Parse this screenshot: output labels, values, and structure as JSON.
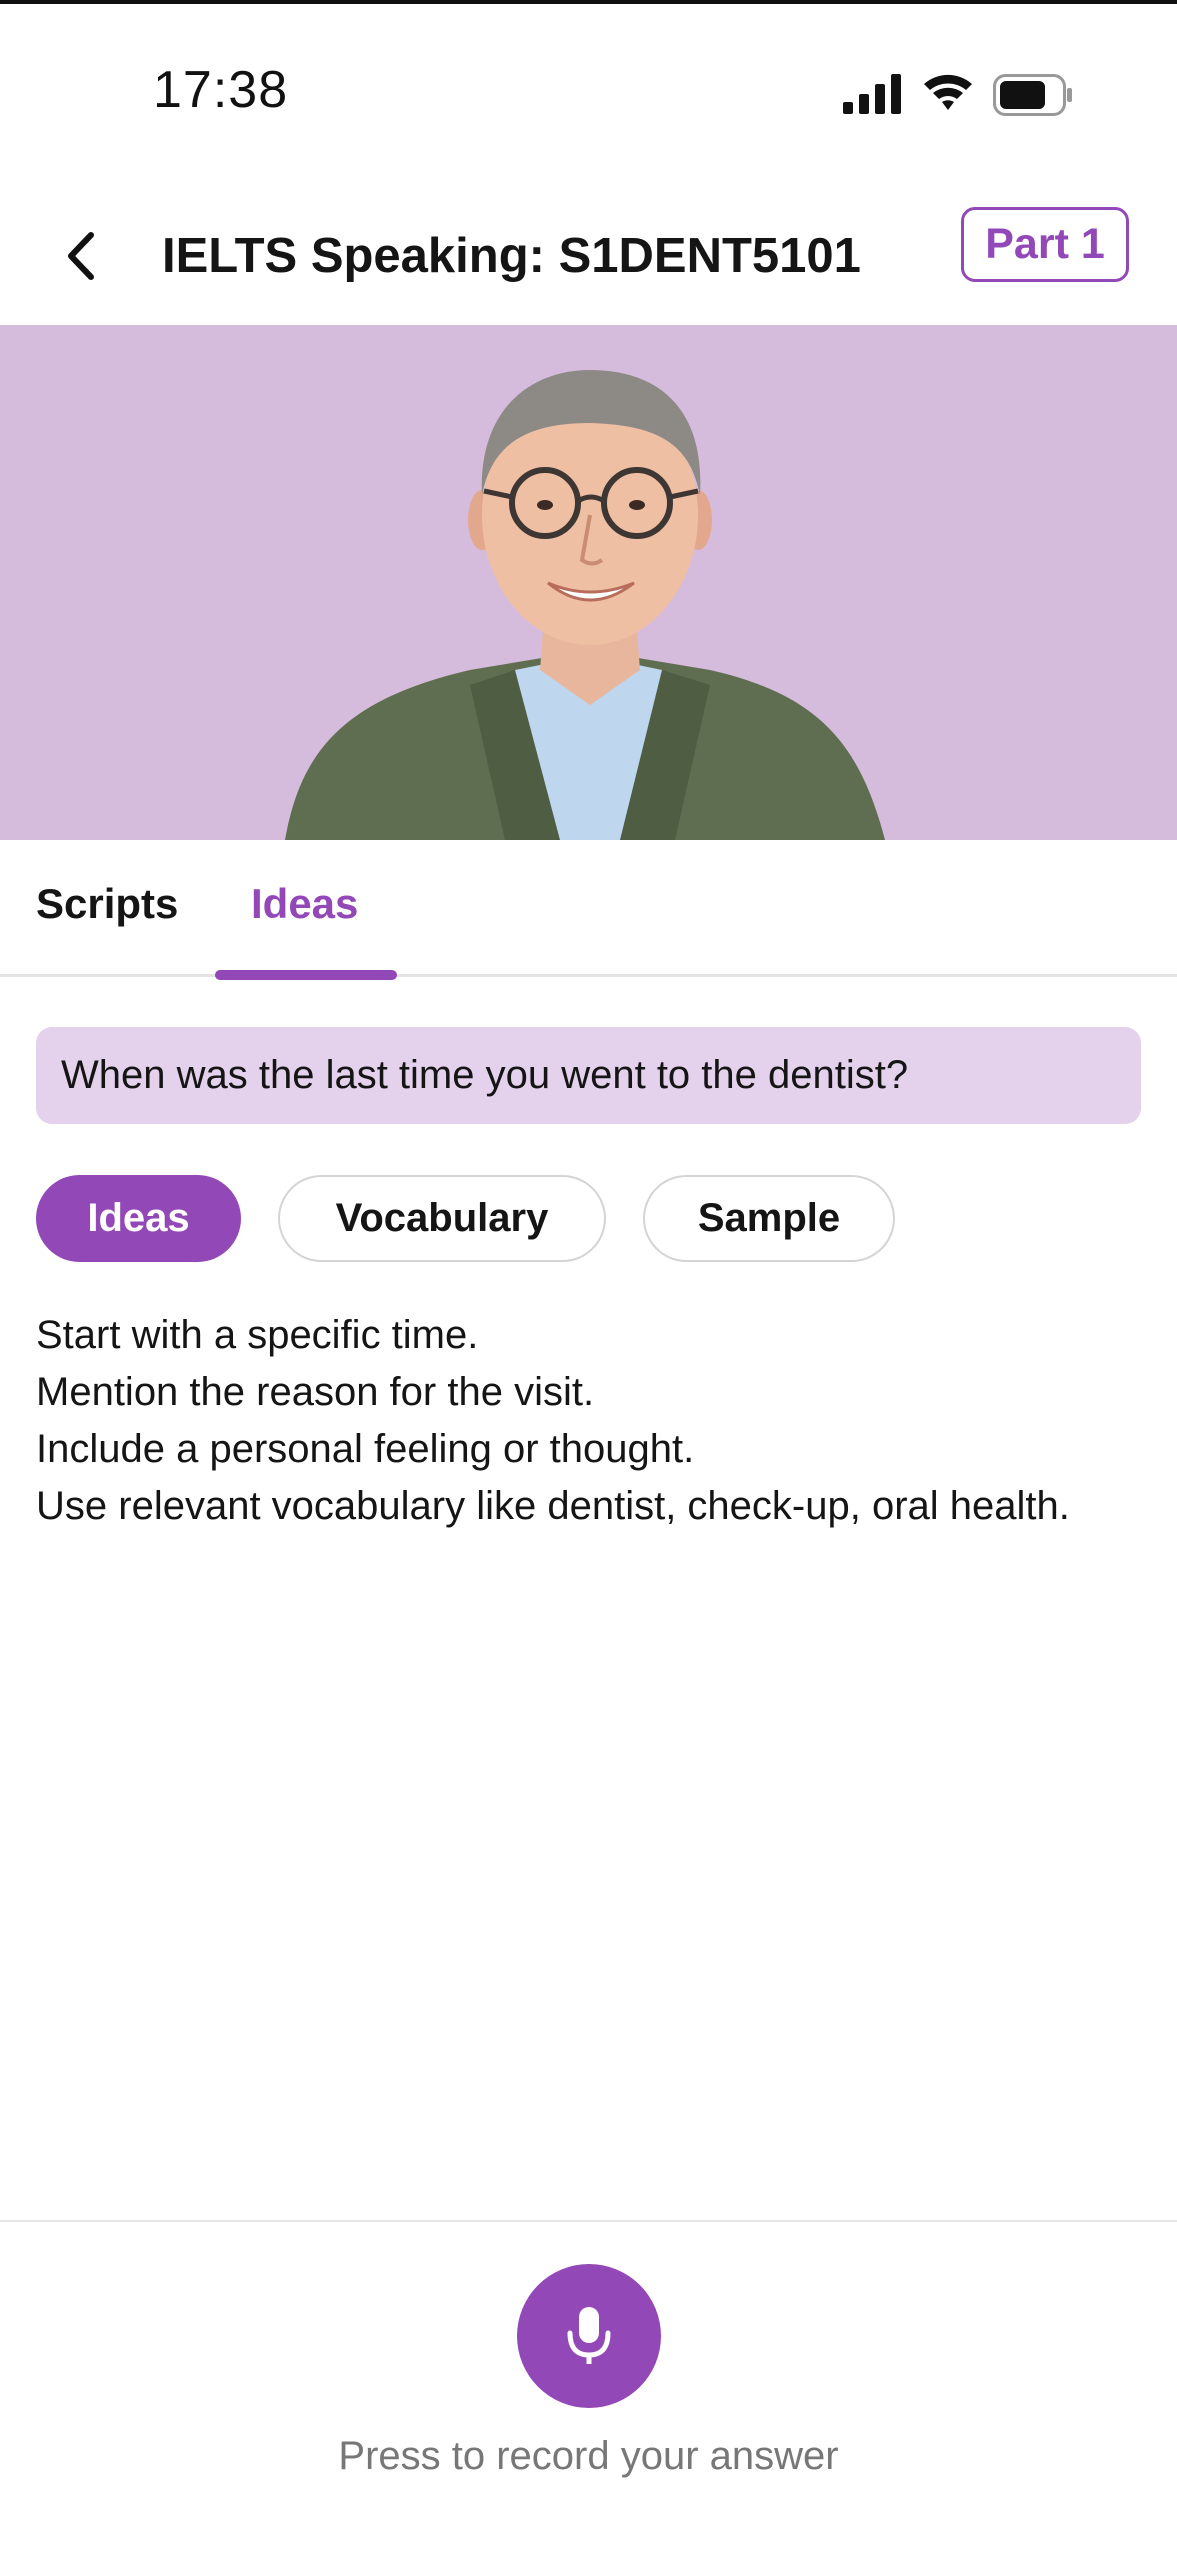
{
  "status_bar": {
    "time": "17:38",
    "icons": [
      "signal-icon",
      "wifi-icon",
      "battery-icon"
    ]
  },
  "header": {
    "back_icon": "chevron-left-icon",
    "title": "IELTS Speaking: S1DENT5101",
    "part_label": "Part 1"
  },
  "hero": {
    "image": "examiner-portrait",
    "background_color": "#d5bcdc"
  },
  "tabs": {
    "items": [
      "Scripts",
      "Ideas"
    ],
    "active": "Ideas"
  },
  "question": "When was the last time you went to the dentist?",
  "chips": {
    "items": [
      "Ideas",
      "Vocabulary",
      "Sample"
    ],
    "active": "Ideas"
  },
  "ideas": [
    "Start with a specific time.",
    "Mention the reason for the visit.",
    "Include a personal feeling or thought.",
    "Use relevant vocabulary like dentist, check-up, oral health."
  ],
  "record": {
    "icon": "microphone-icon",
    "hint": "Press to record your answer"
  },
  "colors": {
    "accent": "#9348b8",
    "question_bg": "#e4d1ec"
  }
}
